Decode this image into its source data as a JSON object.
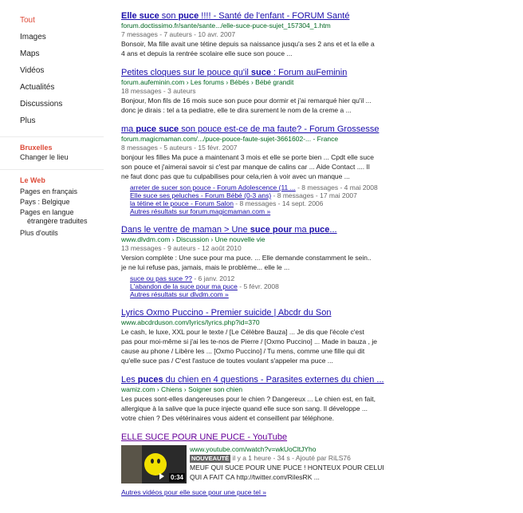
{
  "leftnav": {
    "items": [
      "Tout",
      "Images",
      "Maps",
      "Vidéos",
      "Actualités",
      "Discussions",
      "Plus"
    ],
    "location": {
      "city": "Bruxelles",
      "change": "Changer le lieu"
    },
    "web": {
      "title": "Le Web",
      "pages_fr": "Pages en français",
      "pays": "Pays : Belgique",
      "pages_trad_1": "Pages en langue",
      "pages_trad_2": "étrangère traduites",
      "plus_outils": "Plus d'outils"
    }
  },
  "results": [
    {
      "title_parts": [
        "Elle suce",
        " son ",
        "puce",
        " !!!! - Santé de l'enfant - FORUM Santé"
      ],
      "url": "forum.doctissimo.fr/sante/sante.../elle-suce-puce-sujet_157304_1.htm",
      "meta": "7 messages - 7 auteurs - 10 avr. 2007",
      "snippet_lines": [
        "Bonsoir, Ma fille avait une tétine depuis sa naissance jusqu'a ses 2 ans et et la elle a",
        "4 ans et depuis la rentrée scolaire elle suce son pouce ..."
      ]
    },
    {
      "title_parts": [
        "Petites cloques sur le pouce qu'il ",
        "suce",
        " : Forum auFeminin"
      ],
      "url": "forum.aufeminin.com › Les forums › Bébés › Bébé grandit",
      "meta": "18 messages - 3 auteurs",
      "snippet_lines": [
        "Bonjour, Mon fils de 16 mois suce son puce pour dormir et j'ai remarqué hier qu'il ...",
        "donc je dirais : tel a ta pediatre, elle te dira surement le nom de la creme a ..."
      ]
    },
    {
      "title_parts": [
        "ma ",
        "puce",
        " ",
        "suce",
        " son pouce est-ce de ma faute? - Forum Grossesse"
      ],
      "url": "forum.magicmaman.com/.../puce-pouce-faute-sujet-3661602-... - France",
      "meta": "8 messages - 5 auteurs - 15 févr. 2007",
      "snippet_lines": [
        "bonjour les filles Ma puce a maintenant 3 mois et elle se porte bien ... Cpdt elle suce",
        "son pouce et j'aimerai savoir si c'est par manque de calins car ... Aide Contact .... Il",
        "ne faut donc pas que tu culpabilises pour cela,rien à voir avec un manque ..."
      ],
      "sublinks": [
        {
          "text": "arreter de sucer son pouce - Forum Adolescence (11 ...",
          "meta": " - 8 messages - 4 mai 2008"
        },
        {
          "text": "Elle suce ses peluches - Forum Bébé (0-3 ans)",
          "meta": " - 8 messages - 17 mai 2007"
        },
        {
          "text": "la tétine et le pouce - Forum Salon",
          "meta": " - 8 messages - 14 sept. 2006"
        }
      ],
      "more": "Autres résultats sur forum.magicmaman.com »"
    },
    {
      "title_parts": [
        "Dans le ventre de maman > Une ",
        "suce",
        " ",
        "pour",
        " ma ",
        "puce",
        "..."
      ],
      "url": "www.dlvdm.com › Discussion › Une nouvelle vie",
      "meta": "13 messages - 9 auteurs - 12 août 2010",
      "snippet_lines": [
        "Version complète : Une suce pour ma puce. ... Elle demande constamment le sein..",
        "je ne lui refuse pas, jamais, mais le problème... elle le ..."
      ],
      "sublinks": [
        {
          "text": "suce ou pas suce ??",
          "meta": " - 6 janv. 2012"
        },
        {
          "text": "L'abandon de la suce pour ma puce",
          "meta": " - 5 févr. 2008"
        }
      ],
      "more": "Autres résultats sur dlvdm.com »"
    },
    {
      "title_parts": [
        "Lyrics Oxmo Puccino - Premier suicide | Abcdr du Son"
      ],
      "url": "www.abcdrduson.com/lyrics/lyrics.php?id=370",
      "meta": "",
      "snippet_lines": [
        "Le cash, le luxe, XXL pour le texte / [Le Célèbre Bauza] ... Je dis que l'école c'est",
        "pas pour moi-même si j'ai les te-nos de Pierre / [Oxmo Puccino] ... Made in bauza , je",
        "cause au phone / Libère les ... [Oxmo Puccino] / Tu mens, comme une fille qui dit",
        "qu'elle suce pas / C'est l'astuce de toutes voulant s'appeler ma puce ..."
      ]
    },
    {
      "title_parts": [
        "Les ",
        "puces",
        " du chien en 4 questions - Parasites externes du chien ..."
      ],
      "url": "wamiz.com › Chiens › Soigner son chien",
      "meta": "",
      "snippet_lines": [
        "Les puces sont-elles dangereuses pour le chien ? Dangereux ... Le chien est, en fait,",
        "allergique à la salive que la puce injecte quand elle suce son sang. Il développe ...",
        "votre chien ? Des vétérinaires vous aident et conseillent par téléphone."
      ]
    }
  ],
  "video": {
    "title": "ELLE SUCE POUR UNE PUCE - YouTube",
    "url": "www.youtube.com/watch?v=wkUoCltJYho",
    "badge": "NOUVEAUTÉ",
    "meta": " il y a 1 heure - 34 s - Ajouté par RiLS76",
    "desc_1": "MEUF QUI SUCE POUR UNE PUCE ! HONTEUX POUR CELUI",
    "desc_2": "QUI A FAIT CA http://twitter.com/RilesRK ...",
    "duration": "0:34",
    "more": "Autres vidéos pour elle suce pour une puce tel »"
  }
}
